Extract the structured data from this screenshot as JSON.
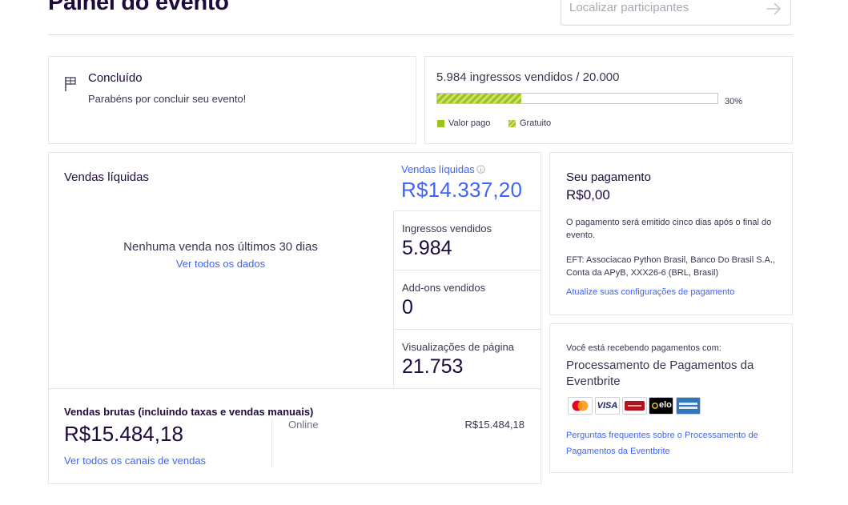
{
  "header": {
    "title": "Painel do evento",
    "search_placeholder": "Localizar participantes"
  },
  "status_card": {
    "title": "Concluído",
    "message": "Parabéns por concluir seu evento!"
  },
  "tickets_card": {
    "summary": "5.984 ingressos vendidos / 20.000",
    "progress_fraction": 0.3,
    "percent_label": "30%",
    "legend_paid": "Valor pago",
    "legend_free": "Gratuito",
    "colors": {
      "paid": "#9bc31e",
      "free": "#cde46a"
    }
  },
  "sales": {
    "title": "Vendas líquidas",
    "empty_message": "Nenhuma venda nos últimos 30 dias",
    "view_all_link": "Ver todos os dados",
    "net_label": "Vendas líquidas",
    "info_icon": "info-icon",
    "net_value": "R$14.337,20",
    "tickets_sold_label": "Ingressos vendidos",
    "tickets_sold_value": "5.984",
    "addons_label": "Add-ons vendidos",
    "addons_value": "0",
    "pageviews_label": "Visualizações de página",
    "pageviews_value": "21.753",
    "gross_label": "Vendas brutas (incluindo taxas e vendas manuais)",
    "gross_value": "R$15.484,18",
    "channels_link": "Ver todos os canais de vendas",
    "channel_name": "Online",
    "channel_value": "R$15.484,18"
  },
  "payment": {
    "title": "Seu pagamento",
    "amount": "R$0,00",
    "note": "O pagamento será emitido cinco dias após o final do evento.",
    "eft": "EFT: Associacao Python Brasil, Banco Do Brasil S.A., Conta da APyB, XXX26-6 (BRL, Brasil)",
    "settings_link": "Atualize suas configurações de pagamento"
  },
  "processing": {
    "intro": "Você está recebendo pagamentos com:",
    "name": "Processamento de Pagamentos da Eventbrite",
    "faq_link": "Perguntas frequentes sobre o Processamento de Pagamentos da Eventbrite",
    "logos": [
      "mastercard-logo",
      "visa-logo",
      "hipercard-logo",
      "elo-logo",
      "amex-logo"
    ],
    "visa_text": "VISA",
    "elo_text": "elo"
  }
}
